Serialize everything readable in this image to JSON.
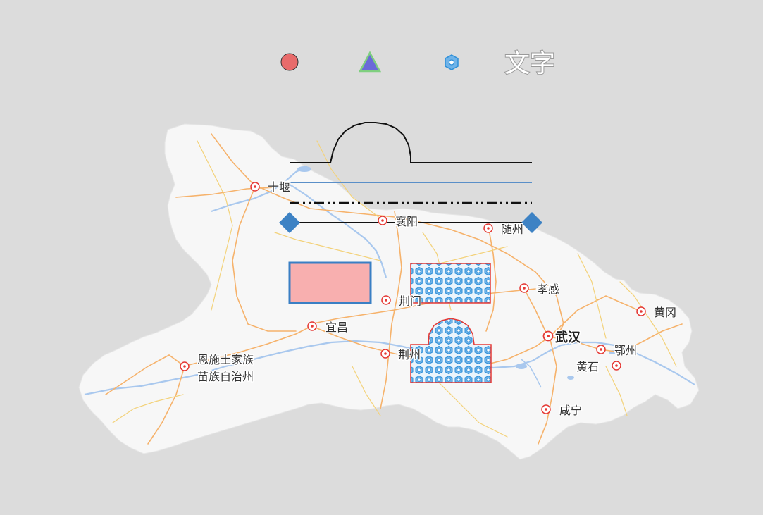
{
  "legend": {
    "text_sample": "文字"
  },
  "colors": {
    "background": "#dcdcdc",
    "province_fill": "#f7f7f7",
    "province_outline": "#e6e6e6",
    "road_orange": "#f6b26b",
    "road_yellow": "#f3d27a",
    "water": "#a9c8ee",
    "city_marker": "#e53935",
    "circle_fill": "#e86b6b",
    "triangle_fill": "#6a6ad8",
    "triangle_stroke": "#7fcf7f",
    "rect_fill": "#f7a8a8",
    "rect_stroke": "#3a7fc4",
    "pattern_stroke": "#e53935",
    "pattern_blue": "#2e8fd8",
    "line_blue": "#5a8fc8",
    "diamond": "#3d82c4"
  },
  "icons": {
    "legend_circle": "circle-icon",
    "legend_triangle": "triangle-icon",
    "legend_pattern": "hexagon-pattern-icon",
    "city": "city-marker-icon"
  },
  "cities": [
    {
      "id": "shiyan",
      "name": "十堰"
    },
    {
      "id": "xiangyang",
      "name": "襄阳"
    },
    {
      "id": "suizhou",
      "name": "随州"
    },
    {
      "id": "xiaogan",
      "name": "孝感"
    },
    {
      "id": "jingmen",
      "name": "荆门"
    },
    {
      "id": "huanggang",
      "name": "黄冈"
    },
    {
      "id": "yichang",
      "name": "宜昌"
    },
    {
      "id": "wuhan",
      "name": "武汉"
    },
    {
      "id": "ezhou",
      "name": "鄂州"
    },
    {
      "id": "jingzhou",
      "name": "荆州"
    },
    {
      "id": "huangshi",
      "name": "黄石"
    },
    {
      "id": "enshi",
      "name": "恩施土家族\n苗族自治州"
    },
    {
      "id": "xianning",
      "name": "咸宁"
    }
  ]
}
